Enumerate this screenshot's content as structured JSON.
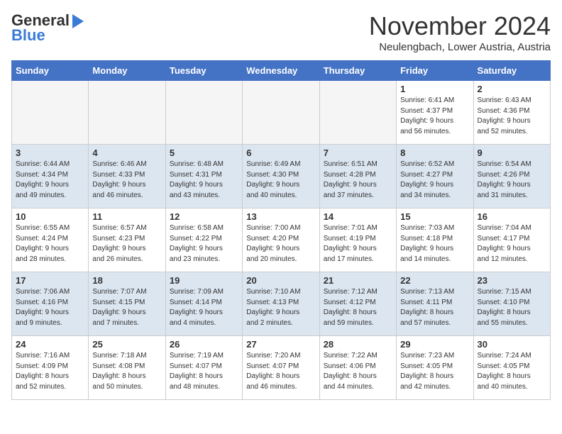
{
  "header": {
    "logo_line1": "General",
    "logo_line2": "Blue",
    "month": "November 2024",
    "location": "Neulengbach, Lower Austria, Austria"
  },
  "days_of_week": [
    "Sunday",
    "Monday",
    "Tuesday",
    "Wednesday",
    "Thursday",
    "Friday",
    "Saturday"
  ],
  "weeks": [
    {
      "days": [
        {
          "date": "",
          "info": "",
          "empty": true
        },
        {
          "date": "",
          "info": "",
          "empty": true
        },
        {
          "date": "",
          "info": "",
          "empty": true
        },
        {
          "date": "",
          "info": "",
          "empty": true
        },
        {
          "date": "",
          "info": "",
          "empty": true
        },
        {
          "date": "1",
          "info": "Sunrise: 6:41 AM\nSunset: 4:37 PM\nDaylight: 9 hours\nand 56 minutes.",
          "empty": false
        },
        {
          "date": "2",
          "info": "Sunrise: 6:43 AM\nSunset: 4:36 PM\nDaylight: 9 hours\nand 52 minutes.",
          "empty": false
        }
      ]
    },
    {
      "days": [
        {
          "date": "3",
          "info": "Sunrise: 6:44 AM\nSunset: 4:34 PM\nDaylight: 9 hours\nand 49 minutes.",
          "empty": false
        },
        {
          "date": "4",
          "info": "Sunrise: 6:46 AM\nSunset: 4:33 PM\nDaylight: 9 hours\nand 46 minutes.",
          "empty": false
        },
        {
          "date": "5",
          "info": "Sunrise: 6:48 AM\nSunset: 4:31 PM\nDaylight: 9 hours\nand 43 minutes.",
          "empty": false
        },
        {
          "date": "6",
          "info": "Sunrise: 6:49 AM\nSunset: 4:30 PM\nDaylight: 9 hours\nand 40 minutes.",
          "empty": false
        },
        {
          "date": "7",
          "info": "Sunrise: 6:51 AM\nSunset: 4:28 PM\nDaylight: 9 hours\nand 37 minutes.",
          "empty": false
        },
        {
          "date": "8",
          "info": "Sunrise: 6:52 AM\nSunset: 4:27 PM\nDaylight: 9 hours\nand 34 minutes.",
          "empty": false
        },
        {
          "date": "9",
          "info": "Sunrise: 6:54 AM\nSunset: 4:26 PM\nDaylight: 9 hours\nand 31 minutes.",
          "empty": false
        }
      ]
    },
    {
      "days": [
        {
          "date": "10",
          "info": "Sunrise: 6:55 AM\nSunset: 4:24 PM\nDaylight: 9 hours\nand 28 minutes.",
          "empty": false
        },
        {
          "date": "11",
          "info": "Sunrise: 6:57 AM\nSunset: 4:23 PM\nDaylight: 9 hours\nand 26 minutes.",
          "empty": false
        },
        {
          "date": "12",
          "info": "Sunrise: 6:58 AM\nSunset: 4:22 PM\nDaylight: 9 hours\nand 23 minutes.",
          "empty": false
        },
        {
          "date": "13",
          "info": "Sunrise: 7:00 AM\nSunset: 4:20 PM\nDaylight: 9 hours\nand 20 minutes.",
          "empty": false
        },
        {
          "date": "14",
          "info": "Sunrise: 7:01 AM\nSunset: 4:19 PM\nDaylight: 9 hours\nand 17 minutes.",
          "empty": false
        },
        {
          "date": "15",
          "info": "Sunrise: 7:03 AM\nSunset: 4:18 PM\nDaylight: 9 hours\nand 14 minutes.",
          "empty": false
        },
        {
          "date": "16",
          "info": "Sunrise: 7:04 AM\nSunset: 4:17 PM\nDaylight: 9 hours\nand 12 minutes.",
          "empty": false
        }
      ]
    },
    {
      "days": [
        {
          "date": "17",
          "info": "Sunrise: 7:06 AM\nSunset: 4:16 PM\nDaylight: 9 hours\nand 9 minutes.",
          "empty": false
        },
        {
          "date": "18",
          "info": "Sunrise: 7:07 AM\nSunset: 4:15 PM\nDaylight: 9 hours\nand 7 minutes.",
          "empty": false
        },
        {
          "date": "19",
          "info": "Sunrise: 7:09 AM\nSunset: 4:14 PM\nDaylight: 9 hours\nand 4 minutes.",
          "empty": false
        },
        {
          "date": "20",
          "info": "Sunrise: 7:10 AM\nSunset: 4:13 PM\nDaylight: 9 hours\nand 2 minutes.",
          "empty": false
        },
        {
          "date": "21",
          "info": "Sunrise: 7:12 AM\nSunset: 4:12 PM\nDaylight: 8 hours\nand 59 minutes.",
          "empty": false
        },
        {
          "date": "22",
          "info": "Sunrise: 7:13 AM\nSunset: 4:11 PM\nDaylight: 8 hours\nand 57 minutes.",
          "empty": false
        },
        {
          "date": "23",
          "info": "Sunrise: 7:15 AM\nSunset: 4:10 PM\nDaylight: 8 hours\nand 55 minutes.",
          "empty": false
        }
      ]
    },
    {
      "days": [
        {
          "date": "24",
          "info": "Sunrise: 7:16 AM\nSunset: 4:09 PM\nDaylight: 8 hours\nand 52 minutes.",
          "empty": false
        },
        {
          "date": "25",
          "info": "Sunrise: 7:18 AM\nSunset: 4:08 PM\nDaylight: 8 hours\nand 50 minutes.",
          "empty": false
        },
        {
          "date": "26",
          "info": "Sunrise: 7:19 AM\nSunset: 4:07 PM\nDaylight: 8 hours\nand 48 minutes.",
          "empty": false
        },
        {
          "date": "27",
          "info": "Sunrise: 7:20 AM\nSunset: 4:07 PM\nDaylight: 8 hours\nand 46 minutes.",
          "empty": false
        },
        {
          "date": "28",
          "info": "Sunrise: 7:22 AM\nSunset: 4:06 PM\nDaylight: 8 hours\nand 44 minutes.",
          "empty": false
        },
        {
          "date": "29",
          "info": "Sunrise: 7:23 AM\nSunset: 4:05 PM\nDaylight: 8 hours\nand 42 minutes.",
          "empty": false
        },
        {
          "date": "30",
          "info": "Sunrise: 7:24 AM\nSunset: 4:05 PM\nDaylight: 8 hours\nand 40 minutes.",
          "empty": false
        }
      ]
    }
  ]
}
